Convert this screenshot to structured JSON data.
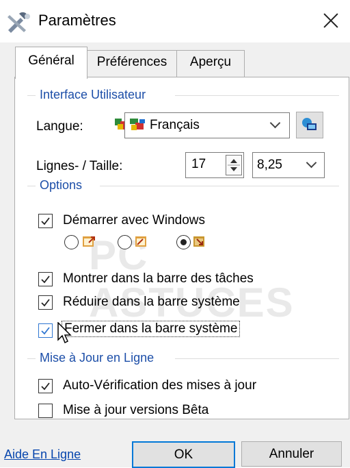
{
  "window": {
    "title": "Paramètres",
    "close_glyph": "close-icon"
  },
  "tabs": [
    {
      "label": "Général",
      "active": true
    },
    {
      "label": "Préférences",
      "active": false
    },
    {
      "label": "Aperçu",
      "active": false
    }
  ],
  "interface": {
    "group_label": "Interface Utilisateur",
    "language_label": "Langue:",
    "language_value": "Français",
    "lines_size_label": "Lignes- / Taille:",
    "lines_value": "17",
    "size_value": "8,25"
  },
  "options": {
    "group_label": "Options",
    "start_with_windows": {
      "label": "Démarrer avec Windows",
      "checked": true
    },
    "startup_modes": [
      {
        "selected": false
      },
      {
        "selected": false
      },
      {
        "selected": true
      }
    ],
    "show_in_taskbar": {
      "label": "Montrer dans la barre des tâches",
      "checked": true
    },
    "minimize_to_tray": {
      "label": "Réduire dans la barre système",
      "checked": true
    },
    "close_to_tray": {
      "label": "Fermer dans la barre système",
      "checked": true
    }
  },
  "updates": {
    "group_label": "Mise à Jour en Ligne",
    "auto_check": {
      "label": "Auto-Vérification des mises à jour",
      "checked": true
    },
    "beta_versions": {
      "label": "Mise à jour versions Bêta",
      "checked": false
    }
  },
  "footer": {
    "help_link": "Aide En Ligne",
    "ok_label": "OK",
    "cancel_label": "Annuler"
  },
  "watermark": "PC ASTUCES",
  "colors": {
    "accent": "#0078d7",
    "group_label": "#1c4ea8",
    "link": "#0645ad"
  }
}
